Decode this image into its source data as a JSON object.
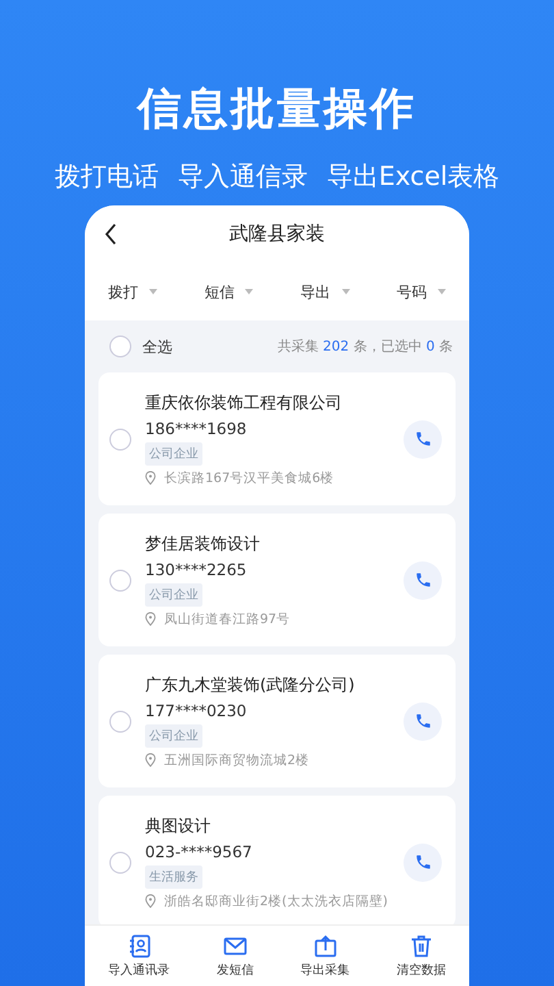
{
  "headline": "信息批量操作",
  "features": [
    "拨打电话",
    "导入通信录",
    "导出Excel表格"
  ],
  "screen": {
    "title": "武隆县家装",
    "filters": [
      "拨打",
      "短信",
      "导出",
      "号码"
    ],
    "select_all": {
      "label": "全选",
      "checked": false,
      "summary_before": "共采集 ",
      "total": "202",
      "summary_middle": " 条，已选中 ",
      "selected_count": "0",
      "summary_after": " 条"
    },
    "contacts": [
      {
        "name": "重庆依你装饰工程有限公司",
        "phone": "186****1698",
        "tag": "公司企业",
        "address": "长滨路167号汉平美食城6楼",
        "checked": false
      },
      {
        "name": "梦佳居装饰设计",
        "phone": "130****2265",
        "tag": "公司企业",
        "address": "凤山街道春江路97号",
        "checked": false
      },
      {
        "name": "广东九木堂装饰(武隆分公司)",
        "phone": "177****0230",
        "tag": "公司企业",
        "address": "五洲国际商贸物流城2楼",
        "checked": false
      },
      {
        "name": "典图设计",
        "phone": "023-****9567",
        "tag": "生活服务",
        "address": "浙皓名邸商业街2楼(太太洗衣店隔壁)",
        "checked": false
      }
    ],
    "bottom_nav": [
      {
        "label": "导入通讯录",
        "kind": "contacts"
      },
      {
        "label": "发短信",
        "kind": "mail"
      },
      {
        "label": "导出采集",
        "kind": "export"
      },
      {
        "label": "清空数据",
        "kind": "trash"
      }
    ]
  }
}
